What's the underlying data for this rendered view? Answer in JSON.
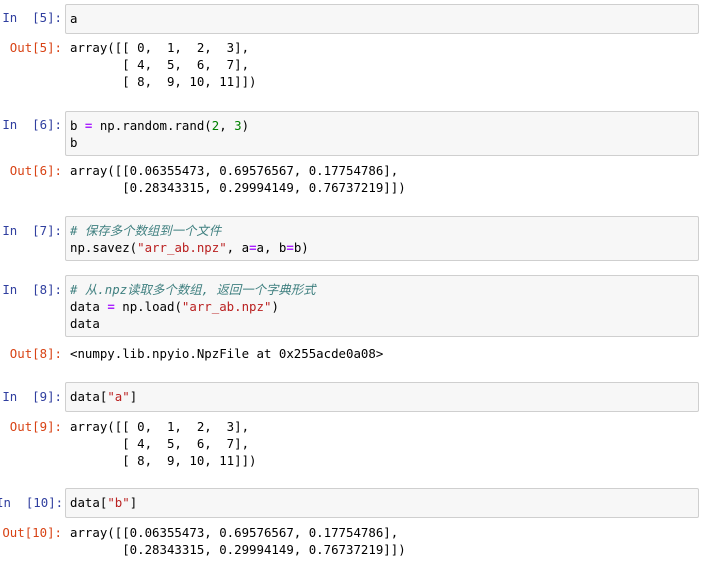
{
  "cells": [
    {
      "in_prompt": "In  [5]:",
      "code": [
        "a"
      ],
      "out_prompt": "Out[5]:",
      "output": [
        "array([[ 0,  1,  2,  3],",
        "       [ 4,  5,  6,  7],",
        "       [ 8,  9, 10, 11]])"
      ]
    },
    {
      "in_prompt": "In  [6]:",
      "code": [
        "b = np.random.rand(2, 3)",
        "b"
      ],
      "out_prompt": "Out[6]:",
      "output": [
        "array([[0.06355473, 0.69576567, 0.17754786],",
        "       [0.28343315, 0.29994149, 0.76737219]])"
      ]
    },
    {
      "in_prompt": "In  [7]:",
      "code": [
        "# 保存多个数组到一个文件",
        "np.savez(\"arr_ab.npz\", a=a, b=b)"
      ],
      "out_prompt": "",
      "output": []
    },
    {
      "in_prompt": "In  [8]:",
      "code": [
        "# 从.npz读取多个数组, 返回一个字典形式",
        "data = np.load(\"arr_ab.npz\")",
        "data"
      ],
      "out_prompt": "Out[8]:",
      "output": [
        "<numpy.lib.npyio.NpzFile at 0x255acde0a08>"
      ]
    },
    {
      "in_prompt": "In  [9]:",
      "code": [
        "data[\"a\"]"
      ],
      "out_prompt": "Out[9]:",
      "output": [
        "array([[ 0,  1,  2,  3],",
        "       [ 4,  5,  6,  7],",
        "       [ 8,  9, 10, 11]])"
      ]
    },
    {
      "in_prompt": "In  [10]:",
      "code": [
        "data[\"b\"]"
      ],
      "out_prompt": "Out[10]:",
      "output": [
        "array([[0.06355473, 0.69576567, 0.17754786],",
        "       [0.28343315, 0.29994149, 0.76737219]])"
      ]
    }
  ]
}
